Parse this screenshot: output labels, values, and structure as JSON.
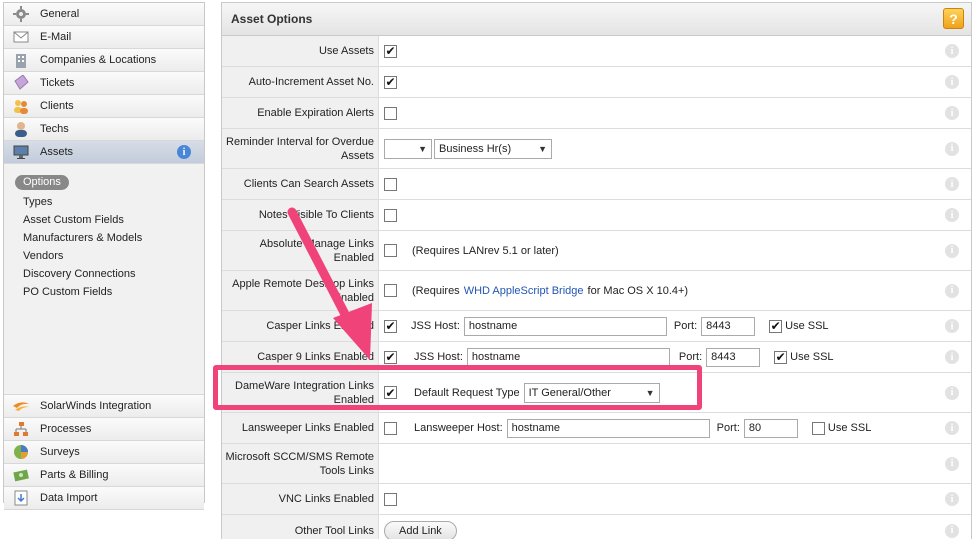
{
  "sidebar": {
    "items_top": [
      {
        "label": "General",
        "icon": "gear-icon"
      },
      {
        "label": "E-Mail",
        "icon": "envelope-icon"
      },
      {
        "label": "Companies & Locations",
        "icon": "building-icon"
      },
      {
        "label": "Tickets",
        "icon": "ticket-icon"
      },
      {
        "label": "Clients",
        "icon": "clients-icon"
      },
      {
        "label": "Techs",
        "icon": "tech-icon"
      },
      {
        "label": "Assets",
        "icon": "monitor-icon"
      }
    ],
    "assets_info_icon": "i",
    "submenu": [
      "Options",
      "Types",
      "Asset Custom Fields",
      "Manufacturers & Models",
      "Vendors",
      "Discovery Connections",
      "PO Custom Fields"
    ],
    "items_bottom": [
      {
        "label": "SolarWinds Integration",
        "icon": "solarwinds-icon"
      },
      {
        "label": "Processes",
        "icon": "processes-icon"
      },
      {
        "label": "Surveys",
        "icon": "survey-icon"
      },
      {
        "label": "Parts & Billing",
        "icon": "billing-icon"
      },
      {
        "label": "Data Import",
        "icon": "import-icon"
      }
    ]
  },
  "panel": {
    "title": "Asset Options",
    "help_icon": "?",
    "row_info_icon": "i",
    "check_mark": "✔",
    "rows": {
      "use_assets": {
        "label": "Use Assets",
        "checked": true
      },
      "auto_increment": {
        "label": "Auto-Increment Asset No.",
        "checked": true
      },
      "expiration_alerts": {
        "label": "Enable Expiration Alerts",
        "checked": false
      },
      "reminder_interval": {
        "label": "Reminder Interval for Overdue Assets",
        "select1": "",
        "select2": "Business Hr(s)"
      },
      "clients_search": {
        "label": "Clients Can Search Assets",
        "checked": false
      },
      "notes_visible": {
        "label": "Notes Visible To Clients",
        "checked": false
      },
      "absolute_manage": {
        "label": "Absolute Manage Links Enabled",
        "checked": false,
        "note": "(Requires LANrev 5.1 or later)"
      },
      "apple_remote": {
        "label": "Apple Remote Desktop Links Enabled",
        "checked": false,
        "note_pre": "(Requires",
        "link": "WHD AppleScript Bridge",
        "note_post": "for Mac OS X 10.4+)"
      },
      "casper": {
        "label": "Casper Links Enabled",
        "checked": true,
        "host_label": "JSS Host:",
        "host_value": "hostname",
        "port_label": "Port:",
        "port_value": "8443",
        "ssl_checked": true,
        "ssl_label": "Use SSL"
      },
      "casper9": {
        "label": "Casper 9 Links Enabled",
        "checked": true,
        "host_label": "JSS Host:",
        "host_value": "hostname",
        "port_label": "Port:",
        "port_value": "8443",
        "ssl_checked": false,
        "ssl_label": "Use SSL"
      },
      "dameware": {
        "label": "DameWare Integration Links Enabled",
        "checked": true,
        "req_type_label": "Default Request Type",
        "req_type_value": "IT General/Other"
      },
      "lansweeper": {
        "label": "Lansweeper Links Enabled",
        "checked": false,
        "host_label": "Lansweeper Host:",
        "host_value": "hostname",
        "port_label": "Port:",
        "port_value": "80",
        "ssl_checked": false,
        "ssl_label": "Use SSL"
      },
      "sccm": {
        "label": "Microsoft SCCM/SMS Remote Tools Links"
      },
      "vnc": {
        "label": "VNC Links Enabled",
        "checked": false
      },
      "other_tools": {
        "label": "Other Tool Links",
        "button": "Add Link"
      }
    }
  },
  "colors": {
    "annotation": "#f0437a",
    "link": "#2355b5",
    "help_badge": "#f0a11b",
    "active_nav": "#c2ccda"
  }
}
